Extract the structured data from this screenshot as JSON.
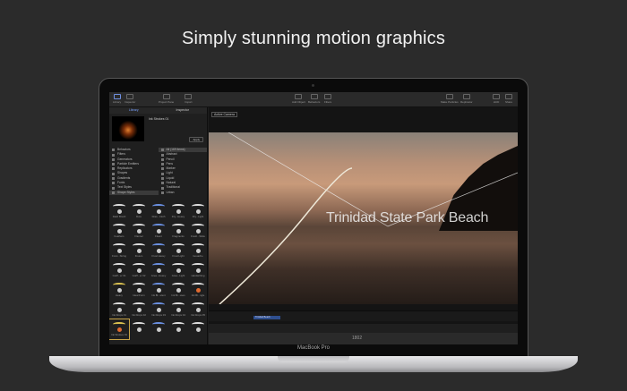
{
  "headline": "Simply stunning motion graphics",
  "device_label": "MacBook Pro",
  "toolbar": {
    "left": [
      "Library",
      "Inspector"
    ],
    "mid_left": [
      "Project Pane",
      "Import"
    ],
    "mid": [
      "Add Object",
      "Behaviors",
      "Filters"
    ],
    "right": [
      "Make Particles",
      "Replicator"
    ],
    "far_right": [
      "HUD",
      "Share"
    ]
  },
  "sidebar": {
    "tabs": [
      "Library",
      "Inspector"
    ],
    "preview_title": "Ink Strokes 01",
    "apply_label": "Apply",
    "categories": [
      "Behaviors",
      "Filters",
      "Generators",
      "Particle Emitters",
      "Replicators",
      "Shapes",
      "Gradients",
      "Fonts",
      "Text Styles",
      "Shape Styles"
    ],
    "subcategories": [
      "All (169 items)",
      "Abstract",
      "Pencil",
      "Pens",
      "Marker",
      "Light",
      "Liquid",
      "Natural",
      "Traditional",
      "Urban"
    ],
    "grid": [
      "Dash Brush",
      "Dots",
      "Dras...Cloth",
      "Dry...Heavy",
      "Dry...Light",
      "Feathers",
      "Flannel",
      "Fluent",
      "Fragments",
      "Fresh...Wide",
      "Frost...String",
      "Fresco",
      "Frost Heavy",
      "Frost Light",
      "Gouache",
      "Graff...er 01",
      "Graff...er 02",
      "Grea...Heavy",
      "Grea...Light",
      "Handwriting",
      "Heavy",
      "Ideal Form",
      "Ink Bl...ulent",
      "Ink Bl...uses",
      "Ink Bl...ngle",
      "Ink Drops 01",
      "Ink Drops 02",
      "Ink Drops 03",
      "Ink Drops 04",
      "Ink Drops 05",
      "Ink Strokes 01",
      "",
      "",
      "",
      ""
    ]
  },
  "viewer": {
    "camera": "Active Camera",
    "title_text": "Trinidad State Park Beach",
    "clip_label": "Trinidad Beach",
    "timecode": "1802"
  }
}
